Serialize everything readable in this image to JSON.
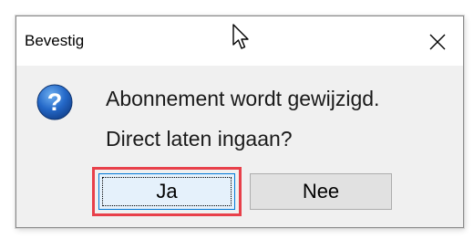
{
  "dialog": {
    "title": "Bevestig",
    "close_symbol": "✕",
    "message_line1": "Abonnement wordt gewijzigd.",
    "message_line2": "Direct laten ingaan?",
    "icon": "question-icon",
    "buttons": {
      "yes_label": "Ja",
      "no_label": "Nee"
    }
  },
  "colors": {
    "dialog_bg": "#f0f0f0",
    "titlebar_bg": "#ffffff",
    "default_button_bg": "#e5f1fb",
    "default_button_border": "#0078d7",
    "button_bg": "#e1e1e1",
    "highlight": "#e8404a",
    "question_icon": "#1e5fb4"
  }
}
